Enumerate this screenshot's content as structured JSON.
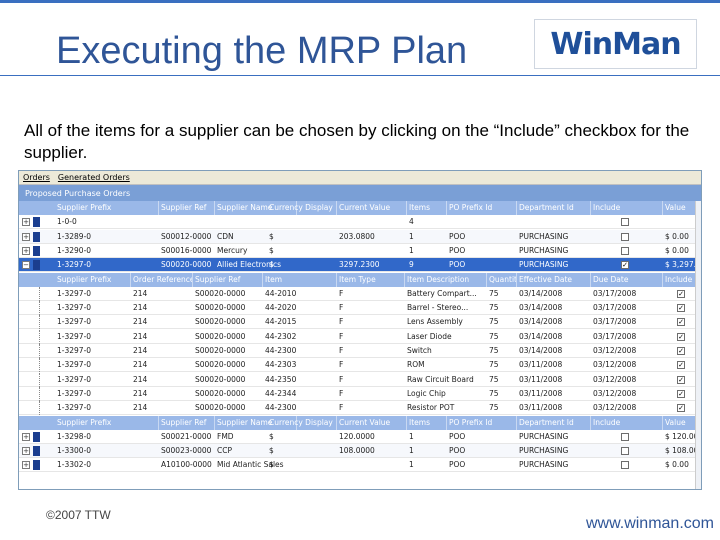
{
  "slide": {
    "title": "Executing the MRP Plan",
    "logo_text": "WinMan",
    "intro_text": "All of the items for a supplier can be chosen by clicking on the “Include” checkbox for the supplier.",
    "footer_copyright": "©2007 TTW",
    "footer_url": "www.winman.com"
  },
  "colors": {
    "title": "#2f5597",
    "header_band": "#3a6fc0",
    "grid_header": "#9ab8e8",
    "selected_row": "#3168c9",
    "panel_title": "#7a9fd6"
  },
  "app": {
    "menu": [
      "Orders",
      "Generated Orders"
    ],
    "panel_title": "Proposed Purchase Orders",
    "order_headers": [
      "Supplier Prefix",
      "Supplier Ref",
      "Supplier Name",
      "Currency Display",
      "Current Value",
      "Items",
      "PO Prefix Id",
      "Department Id",
      "Include",
      "Value"
    ],
    "orders_top": [
      {
        "prefix": "1-0-0",
        "ref": "",
        "name": "",
        "currency": "",
        "current": "",
        "items": "4",
        "po": "",
        "dept": "",
        "include": false,
        "value": ""
      },
      {
        "prefix": "1-3289-0",
        "ref": "S00012-0000",
        "name": "CDN",
        "currency": "$",
        "current": "203.0800",
        "items": "1",
        "po": "POO",
        "dept": "PURCHASING",
        "include": false,
        "value": "$ 0.00"
      },
      {
        "prefix": "1-3290-0",
        "ref": "S00016-0000",
        "name": "Mercury",
        "currency": "$",
        "current": "",
        "items": "1",
        "po": "POO",
        "dept": "PURCHASING",
        "include": false,
        "value": "$ 0.00"
      },
      {
        "prefix": "1-3297-0",
        "ref": "S00020-0000",
        "name": "Allied Electronics",
        "currency": "$",
        "current": "3297.2300",
        "items": "9",
        "po": "POO",
        "dept": "PURCHASING",
        "include": true,
        "value": "$ 3,297.25",
        "selected": true
      }
    ],
    "item_headers": [
      "Supplier Prefix",
      "Order Reference",
      "Supplier Ref",
      "Item",
      "Item Type",
      "Item Description",
      "Quantity",
      "Effective Date",
      "Due Date",
      "Include"
    ],
    "items": [
      {
        "prefix": "1-3297-0",
        "order_ref": "214",
        "sup_ref": "S00020-0000",
        "item": "44-2010",
        "type": "F",
        "desc": "Battery Compart...",
        "qty": "75",
        "eff": "03/14/2008",
        "due": "03/17/2008",
        "include": true
      },
      {
        "prefix": "1-3297-0",
        "order_ref": "214",
        "sup_ref": "S00020-0000",
        "item": "44-2020",
        "type": "F",
        "desc": "Barrel - Stereo...",
        "qty": "75",
        "eff": "03/14/2008",
        "due": "03/17/2008",
        "include": true
      },
      {
        "prefix": "1-3297-0",
        "order_ref": "214",
        "sup_ref": "S00020-0000",
        "item": "44-2015",
        "type": "F",
        "desc": "Lens Assembly",
        "qty": "75",
        "eff": "03/14/2008",
        "due": "03/17/2008",
        "include": true
      },
      {
        "prefix": "1-3297-0",
        "order_ref": "214",
        "sup_ref": "S00020-0000",
        "item": "44-2302",
        "type": "F",
        "desc": "Laser Diode",
        "qty": "75",
        "eff": "03/14/2008",
        "due": "03/17/2008",
        "include": true
      },
      {
        "prefix": "1-3297-0",
        "order_ref": "214",
        "sup_ref": "S00020-0000",
        "item": "44-2300",
        "type": "F",
        "desc": "Switch",
        "qty": "75",
        "eff": "03/14/2008",
        "due": "03/12/2008",
        "include": true
      },
      {
        "prefix": "1-3297-0",
        "order_ref": "214",
        "sup_ref": "S00020-0000",
        "item": "44-2303",
        "type": "F",
        "desc": "ROM",
        "qty": "75",
        "eff": "03/11/2008",
        "due": "03/12/2008",
        "include": true
      },
      {
        "prefix": "1-3297-0",
        "order_ref": "214",
        "sup_ref": "S00020-0000",
        "item": "44-2350",
        "type": "F",
        "desc": "Raw Circuit Board",
        "qty": "75",
        "eff": "03/11/2008",
        "due": "03/12/2008",
        "include": true
      },
      {
        "prefix": "1-3297-0",
        "order_ref": "214",
        "sup_ref": "S00020-0000",
        "item": "44-2344",
        "type": "F",
        "desc": "Logic Chip",
        "qty": "75",
        "eff": "03/11/2008",
        "due": "03/12/2008",
        "include": true
      },
      {
        "prefix": "1-3297-0",
        "order_ref": "214",
        "sup_ref": "S00020-0000",
        "item": "44-2300",
        "type": "F",
        "desc": "Resistor POT",
        "qty": "75",
        "eff": "03/11/2008",
        "due": "03/12/2008",
        "include": true
      }
    ],
    "orders_bottom": [
      {
        "prefix": "1-3298-0",
        "ref": "S00021-0000",
        "name": "FMD",
        "currency": "$",
        "current": "120.0000",
        "items": "1",
        "po": "POO",
        "dept": "PURCHASING",
        "include": false,
        "value": "$ 120.00"
      },
      {
        "prefix": "1-3300-0",
        "ref": "S00023-0000",
        "name": "CCP",
        "currency": "$",
        "current": "108.0000",
        "items": "1",
        "po": "POO",
        "dept": "PURCHASING",
        "include": false,
        "value": "$ 108.00"
      },
      {
        "prefix": "1-3302-0",
        "ref": "A10100-0000",
        "name": "Mid Atlantic Sales",
        "currency": "$",
        "current": "",
        "items": "1",
        "po": "POO",
        "dept": "PURCHASING",
        "include": false,
        "value": "$ 0.00"
      }
    ]
  }
}
